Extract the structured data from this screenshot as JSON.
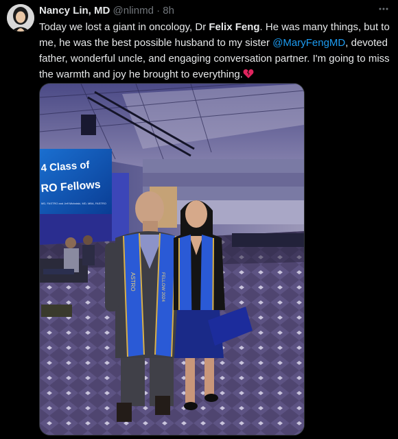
{
  "author": {
    "name": "Nancy Lin, MD",
    "handle": "@nlinmd",
    "separator": "·",
    "time": "8h"
  },
  "tweet": {
    "part1": "Today we lost a giant in oncology, Dr ",
    "bold_name": "Felix Feng",
    "part2": ". He was many things, but to me, he was the best possible husband to my sister ",
    "mention": "@MaryFengMD",
    "part3": ", devoted father, wonderful uncle, and engaging conversation partner. I'm going to miss the warmth and joy he brought to everything.",
    "emoji": "broken-heart-icon"
  },
  "media": {
    "screen_line1": "4 Class of",
    "screen_line2": "RO Fellows",
    "screen_small": "MD, FASTRO and Jeff Michalski, MD, MBA, FASTRO",
    "stole_left_text": "ASTRO",
    "stole_right_text": "FELLOW 2024"
  },
  "colors": {
    "background": "#000000",
    "text": "#e7e9ea",
    "secondary": "#71767b",
    "link": "#1d9bf0",
    "heart": "#e0245e",
    "stole": "#2a5ad6"
  }
}
